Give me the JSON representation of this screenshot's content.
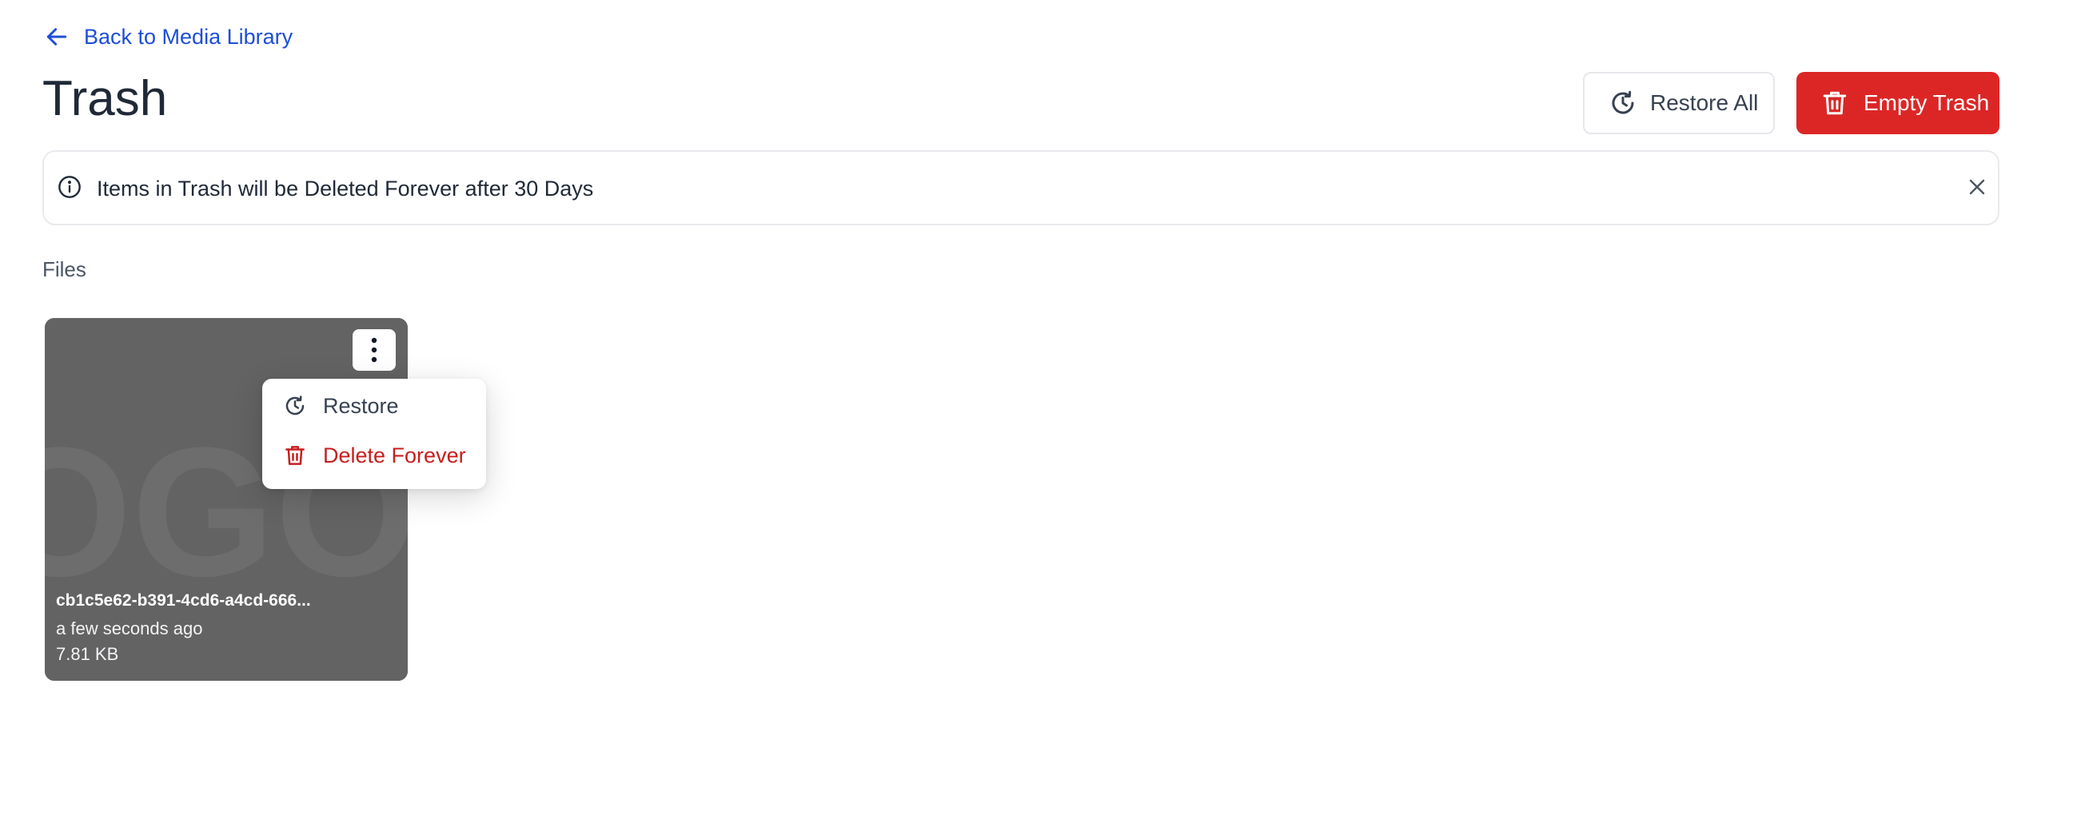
{
  "nav": {
    "back_label": "Back to Media Library"
  },
  "header": {
    "title": "Trash",
    "restore_all_label": "Restore All",
    "empty_trash_label": "Empty Trash"
  },
  "banner": {
    "message": "Items in Trash will be Deleted Forever after 30 Days"
  },
  "files_section": {
    "label": "Files",
    "items": [
      {
        "name": "cb1c5e62-b391-4cd6-a4cd-666...",
        "modified": "a few seconds ago",
        "size": "7.81 KB",
        "thumbnail_text": "OGO"
      }
    ]
  },
  "context_menu": {
    "items": [
      {
        "label": "Restore",
        "icon": "restore-clock-icon"
      },
      {
        "label": "Delete Forever",
        "icon": "trash-icon"
      }
    ]
  },
  "colors": {
    "link": "#1d4ed8",
    "danger": "#dc2626",
    "danger_text": "#c81e1e",
    "card_bg": "#636363",
    "border": "#e5e7eb"
  }
}
